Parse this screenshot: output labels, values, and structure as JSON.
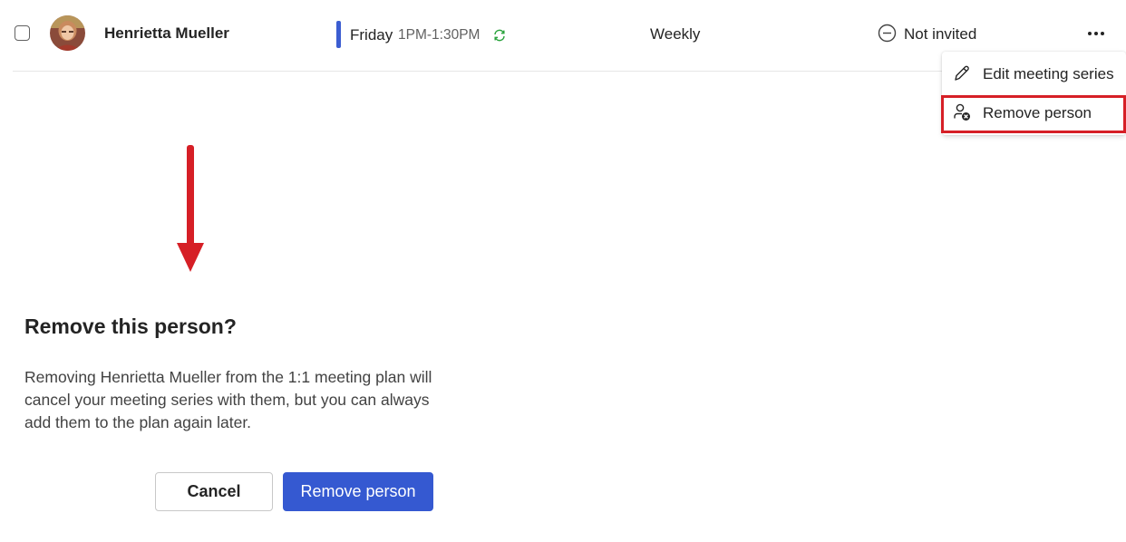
{
  "row": {
    "person_name": "Henrietta Mueller",
    "day": "Friday",
    "time": "1PM-1:30PM",
    "frequency": "Weekly",
    "status": "Not invited",
    "accent_color": "#3b5dd1",
    "recur_icon_color": "#2aa33d"
  },
  "menu": {
    "items": [
      {
        "label": "Edit meeting series",
        "icon": "pencil-icon"
      },
      {
        "label": "Remove person",
        "icon": "person-remove-icon"
      }
    ],
    "highlight_color": "#d61f26"
  },
  "dialog": {
    "title": "Remove this person?",
    "body": "Removing Henrietta Mueller from the 1:1 meeting plan will cancel your meeting series with them, but you can always add them to the plan again later.",
    "cancel_label": "Cancel",
    "confirm_label": "Remove person",
    "primary_color": "#3559d1"
  },
  "annotation": {
    "arrow_color": "#d61f26"
  }
}
